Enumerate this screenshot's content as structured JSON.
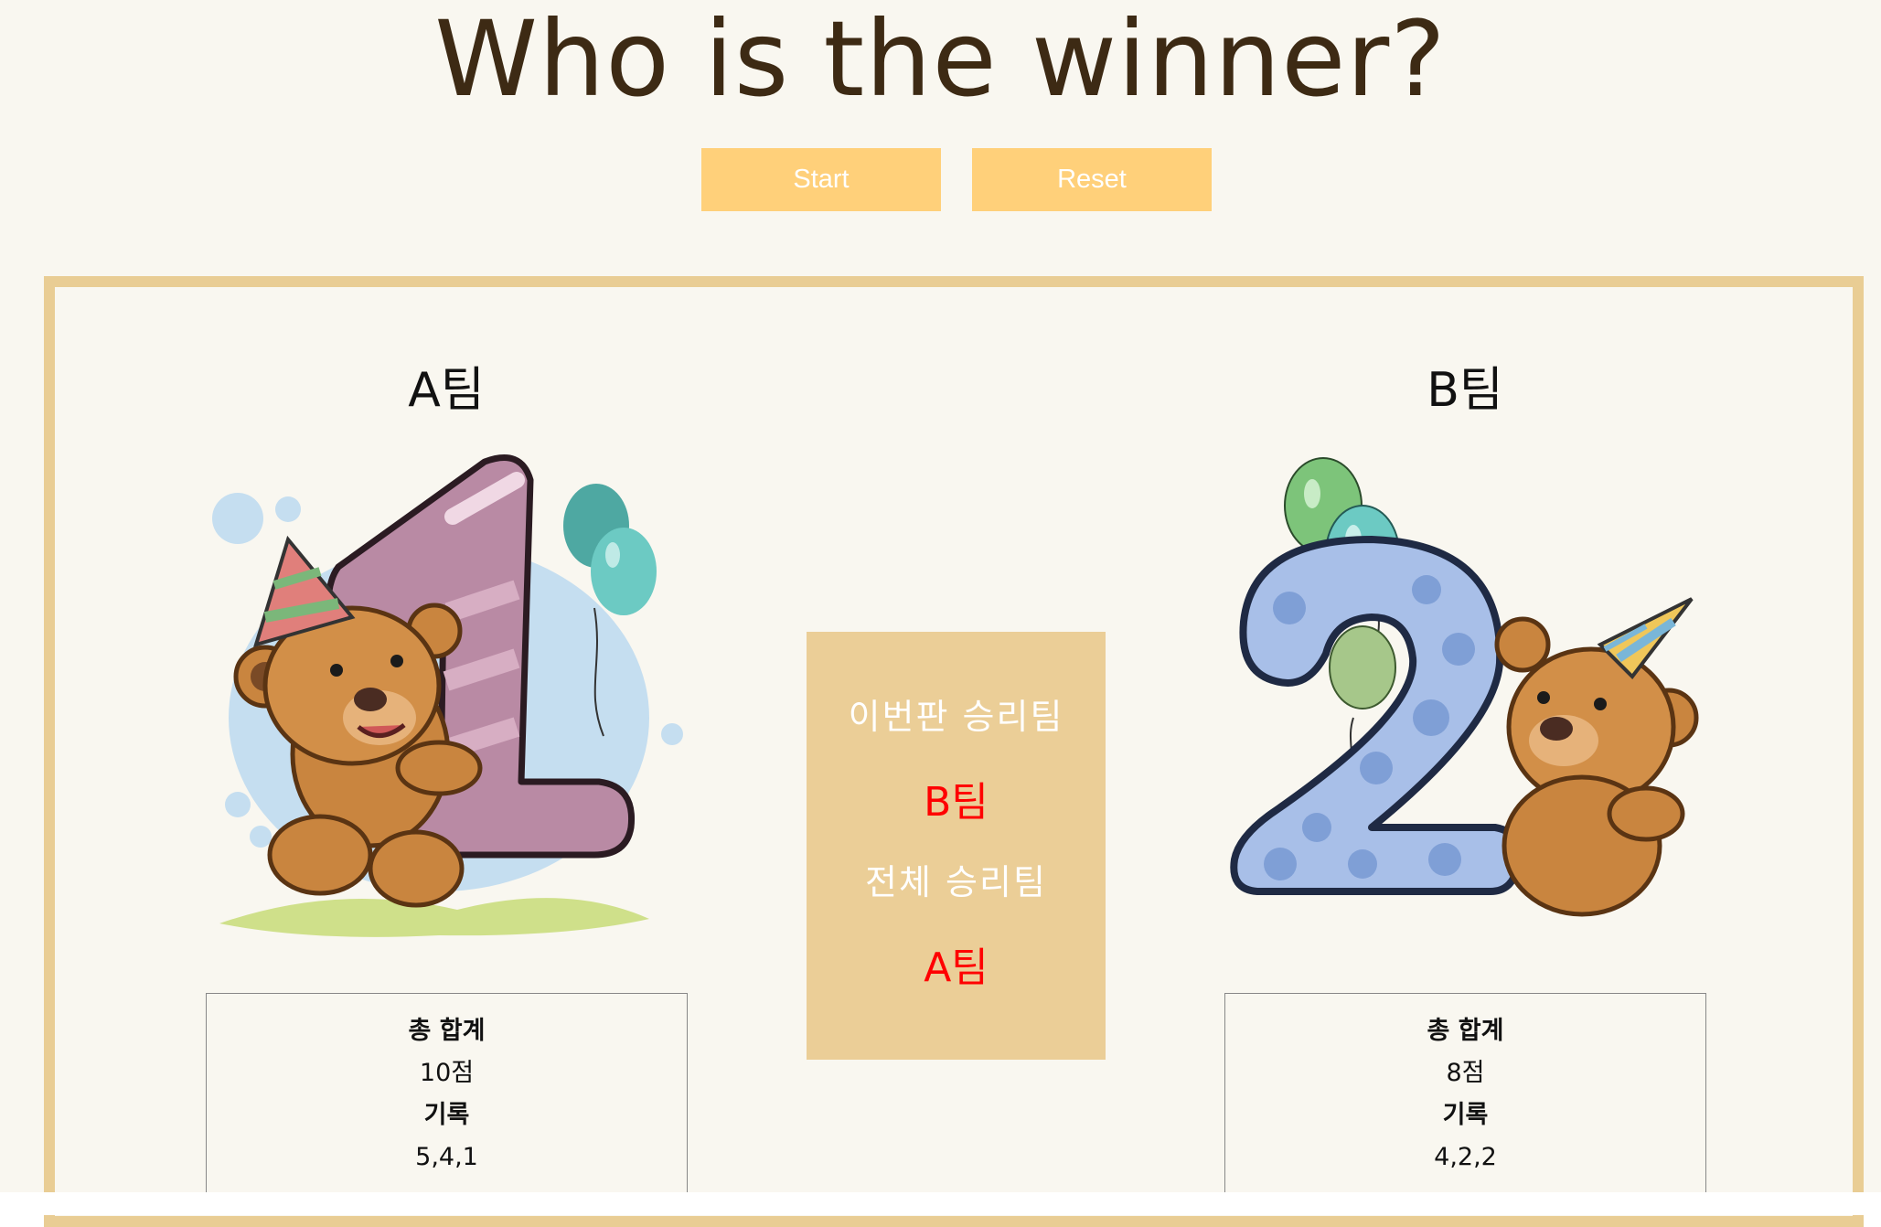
{
  "header": {
    "title": "Who is the winner?",
    "start_label": "Start",
    "reset_label": "Reset"
  },
  "teams": {
    "a": {
      "name": "A팀",
      "total_label": "총 합계",
      "total_value": "10점",
      "record_label": "기록",
      "record_value": "5,4,1",
      "illustration": "teddy-bear-number-one"
    },
    "b": {
      "name": "B팀",
      "total_label": "총 합계",
      "total_value": "8점",
      "record_label": "기록",
      "record_value": "4,2,2",
      "illustration": "teddy-bear-number-two"
    }
  },
  "result": {
    "round_winner_label": "이번판 승리팀",
    "round_winner": "B팀",
    "overall_winner_label": "전체 승리팀",
    "overall_winner": "A팀"
  },
  "colors": {
    "background": "#f9f7f0",
    "button": "#ffd07a",
    "border": "#e9cd94",
    "panel": "#ebce97",
    "title": "#3d2a14",
    "winner_text": "#ff0000"
  }
}
